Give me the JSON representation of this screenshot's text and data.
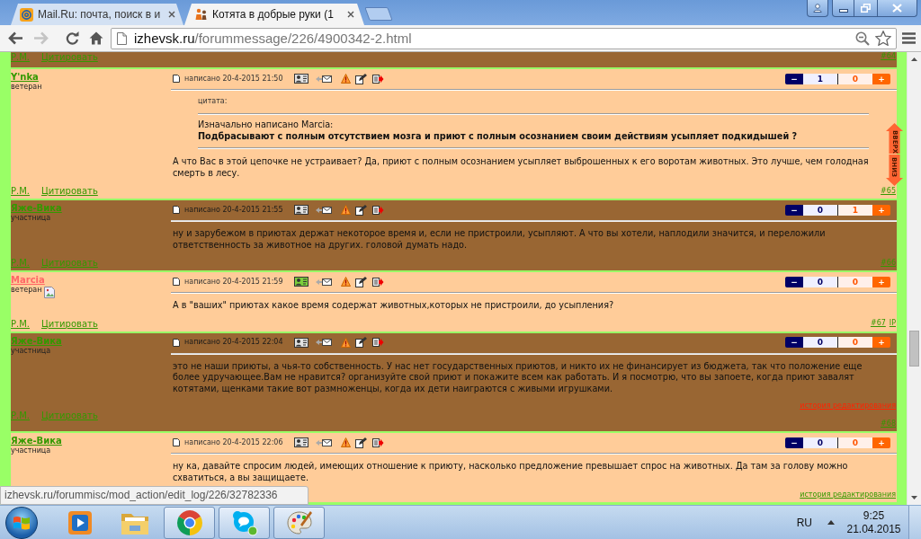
{
  "browser": {
    "tabs": [
      {
        "title": "Mail.Ru: почта, поиск в и",
        "kind": "mail",
        "selected": false
      },
      {
        "title": "Котята в добрые руки (1",
        "kind": "forum",
        "selected": true
      }
    ],
    "navigation": {
      "back_disabled": false,
      "forward_disabled": true
    },
    "address": {
      "host": "izhevsk.ru",
      "path": "/forummessage/226/4900342-2.html"
    }
  },
  "partial_post": {
    "links": [
      "Р.М.",
      "Цитировать"
    ],
    "number": "#64"
  },
  "posts": [
    {
      "author": {
        "name": "Y'nka",
        "color": "#339900",
        "rank": "ветеран"
      },
      "online": false,
      "written": "написано 20-4-2015 21:50",
      "votes": {
        "minus": "−",
        "down": "1",
        "up": "0",
        "plus": "+"
      },
      "quote": {
        "label": "цитата:",
        "attribution": "Изначально написано Marcia:",
        "text": "Подбрасывают с полным отсутствием мозга и приют с полным осознанием своим действиям усыпляет подкидышей ?"
      },
      "body": "А что Вас в этой цепочке не устраивает? Да, приют с полным осознанием усыпляет выброшенных к его воротам животных. Это лучше, чем голодная смерть в лесу.",
      "links": [
        "Р.М.",
        "Цитировать"
      ],
      "number": "#65"
    },
    {
      "author": {
        "name": "Яже-Вика",
        "color": "#339900",
        "rank": "участница"
      },
      "online": false,
      "written": "написано 20-4-2015 21:55",
      "votes": {
        "minus": "−",
        "down": "0",
        "up": "1",
        "plus": "+"
      },
      "body": "ну и зарубежом в приютах держат некоторое время и, если не пристроили, усыпляют. А что вы хотели, наплодили значится, и переложили ответственность за животное на других. головой думать надо.",
      "links": [
        "Р.М.",
        "Цитировать"
      ],
      "number": "#66"
    },
    {
      "author": {
        "name": "Marcia",
        "color": "#ff6666",
        "rank": "ветеран",
        "avatar_broken": true
      },
      "online": true,
      "written": "написано 20-4-2015 21:59",
      "votes": {
        "minus": "−",
        "down": "0",
        "up": "0",
        "plus": "+"
      },
      "body": "А в \"ваших\" приютах какое время содержат животных,которых не пристроили, до усыпления?",
      "links": [
        "Р.М.",
        "Цитировать"
      ],
      "number": "#67",
      "ip": "IP"
    },
    {
      "author": {
        "name": "Яже-Вика",
        "color": "#339900",
        "rank": "участница"
      },
      "online": false,
      "written": "написано 20-4-2015 22:04",
      "votes": {
        "minus": "−",
        "down": "0",
        "up": "0",
        "plus": "+"
      },
      "body": "это не наши приюты, а чья-то собственность. У нас нет государственных приютов, и никто их не финансирует из бюджета, так что положение еще более удручающее.Вам не нравится? организуйте свой приют и покажите всем как работать. И я посмотрю, что вы запоете, когда приют завалят котятами, щенками такие вот размноженцы, когда их дети наиграются с живыми игрушками.",
      "edit_history": {
        "text": "история редактирования",
        "hovered": true
      },
      "links": [
        "Р.М.",
        "Цитировать"
      ],
      "number": "#68"
    },
    {
      "author": {
        "name": "Яже-Вика",
        "color": "#339900",
        "rank": "участница"
      },
      "online": false,
      "written": "написано 20-4-2015 22:06",
      "votes": {
        "minus": "−",
        "down": "0",
        "up": "0",
        "plus": "+"
      },
      "body": "ну ка, давайте спросим людей, имеющих отношение к приюту, насколько предложение превышает спрос на животных. Да там за голову можно схватиться, а вы защищаете.",
      "edit_history": {
        "text": "история редактирования",
        "hovered": false
      }
    }
  ],
  "scroll_nav": {
    "up": "ВВЕРХ",
    "down": "ВНИЗ"
  },
  "status_url": "izhevsk.ru/forummisc/mod_action/edit_log/226/32782336",
  "taskbar": {
    "apps": [
      {
        "kind": "media",
        "running": false
      },
      {
        "kind": "folder",
        "running": false
      },
      {
        "kind": "browser",
        "running": true
      },
      {
        "kind": "messenger",
        "running": true
      },
      {
        "kind": "paint",
        "running": true
      }
    ],
    "language": "RU",
    "time": "9:25",
    "date": "21.04.2015"
  }
}
